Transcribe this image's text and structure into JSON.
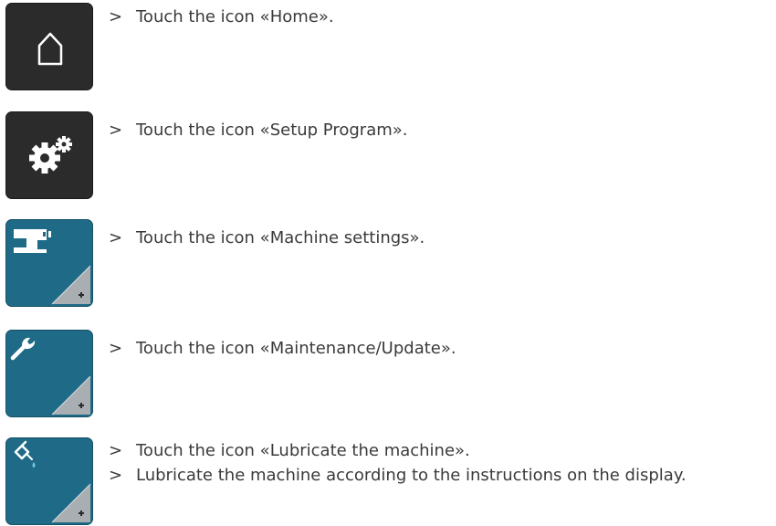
{
  "steps": [
    {
      "icon": "home-icon",
      "lines": [
        "Touch the icon «Home»."
      ]
    },
    {
      "icon": "gears-icon",
      "lines": [
        "Touch the icon «Setup Program»."
      ]
    },
    {
      "icon": "sewing-machine-icon",
      "lines": [
        "Touch the icon «Machine settings»."
      ]
    },
    {
      "icon": "wrench-icon",
      "lines": [
        "Touch the icon «Maintenance/Update»."
      ]
    },
    {
      "icon": "oil-drop-icon",
      "lines": [
        "Touch the icon «Lubricate the machine».",
        "Lubricate the machine according to the instructions on the display."
      ]
    }
  ],
  "bullet": ">",
  "colors": {
    "dark_button": "#2b2b2b",
    "blue_button": "#1f6b87",
    "text": "#3a3a3a"
  }
}
